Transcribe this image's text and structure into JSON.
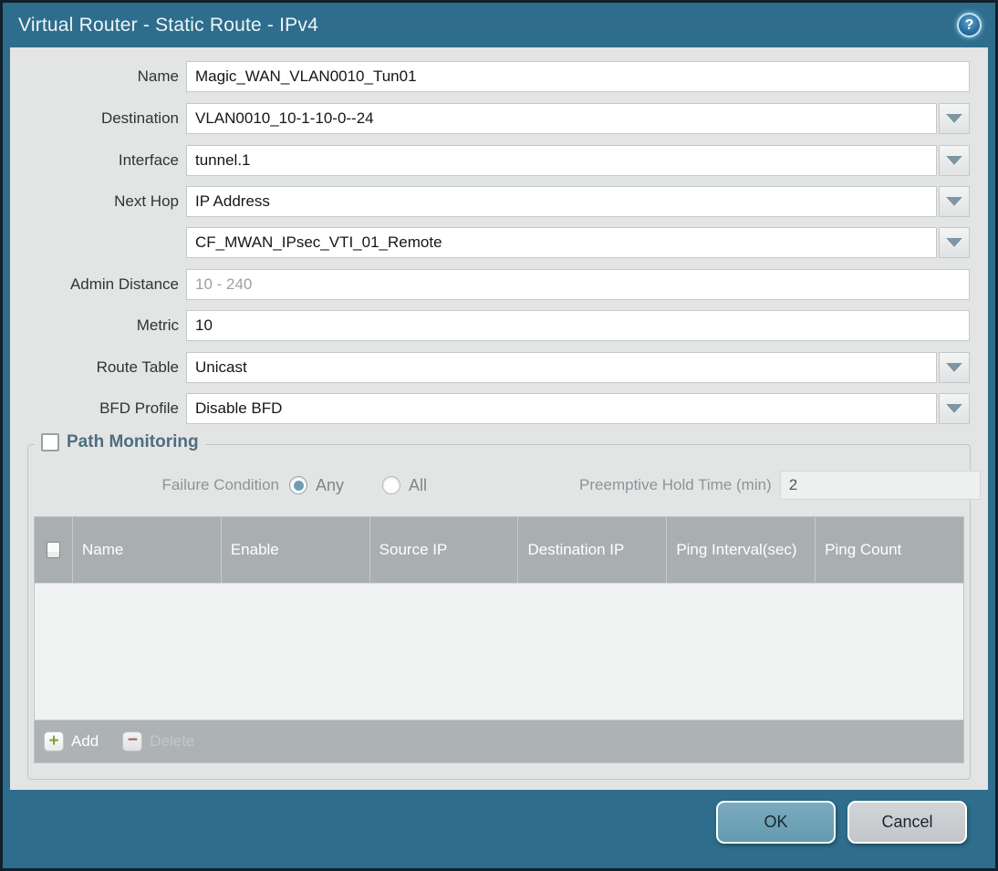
{
  "titlebar": {
    "title": "Virtual Router - Static Route - IPv4"
  },
  "form": {
    "name": {
      "label": "Name",
      "value": "Magic_WAN_VLAN0010_Tun01"
    },
    "destination": {
      "label": "Destination",
      "value": "VLAN0010_10-1-10-0--24"
    },
    "interface": {
      "label": "Interface",
      "value": "tunnel.1"
    },
    "next_hop": {
      "label": "Next Hop",
      "value": "IP Address"
    },
    "next_hop_ip": {
      "value": "CF_MWAN_IPsec_VTI_01_Remote"
    },
    "admin_distance": {
      "label": "Admin Distance",
      "placeholder": "10 - 240"
    },
    "metric": {
      "label": "Metric",
      "value": "10"
    },
    "route_table": {
      "label": "Route Table",
      "value": "Unicast"
    },
    "bfd_profile": {
      "label": "BFD Profile",
      "value": "Disable BFD"
    }
  },
  "path_monitoring": {
    "legend": "Path Monitoring",
    "checkbox_checked": false,
    "failure_condition_label": "Failure Condition",
    "radio_any": "Any",
    "radio_any_selected": true,
    "radio_all": "All",
    "radio_all_selected": false,
    "preemptive_label": "Preemptive Hold Time (min)",
    "preemptive_value": "2",
    "table": {
      "columns": [
        "Name",
        "Enable",
        "Source IP",
        "Destination IP",
        "Ping Interval(sec)",
        "Ping Count"
      ],
      "rows": []
    },
    "toolbar": {
      "add": "Add",
      "delete": "Delete"
    }
  },
  "dialog_footer": {
    "ok": "OK",
    "cancel": "Cancel"
  },
  "colors": {
    "titlebar_teal": "#2e6d8c",
    "outer_border": "#10212c",
    "content_gray": "#e3e5e5",
    "table_header_gray": "#a9aeb1",
    "ok_button_blue": "#6f9fb4",
    "add_icon_green": "#7fa33a",
    "delete_icon_red": "#a05252"
  }
}
